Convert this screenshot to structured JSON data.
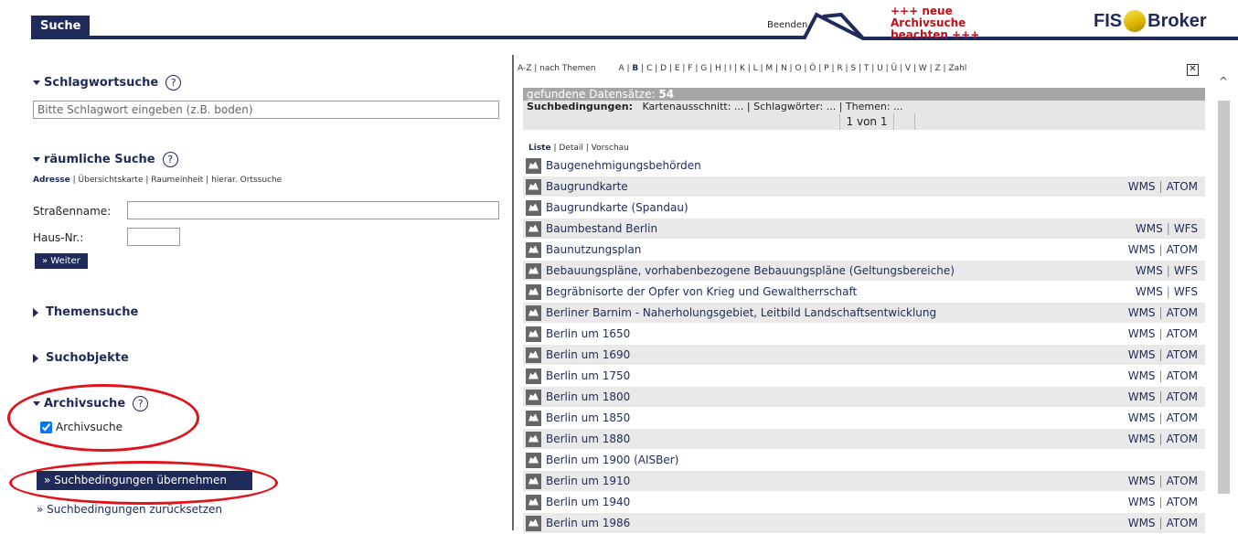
{
  "header": {
    "tab_label": "Suche",
    "beenden": "Beenden",
    "notice_line1": "+++ neue Archivsuche",
    "notice_line2": "beachten +++",
    "logo_left": "FIS",
    "logo_right": "Broker"
  },
  "left": {
    "schlagwort": {
      "title": "Schlagwortsuche",
      "placeholder": "Bitte Schlagwort eingeben (z.B. boden)"
    },
    "raeumlich": {
      "title": "räumliche Suche",
      "nav": [
        "Adresse",
        "Übersichtskarte",
        "Raumeinheit",
        "hierar. Ortssuche"
      ],
      "street_label": "Straßenname:",
      "house_label": "Haus-Nr.:",
      "weiter": "» Weiter"
    },
    "themen": "Themensuche",
    "suchobjekte": "Suchobjekte",
    "archiv": {
      "title": "Archivsuche",
      "checkbox_label": "Archivsuche",
      "checked": true
    },
    "apply_button": "» Suchbedingungen übernehmen",
    "reset_link": "» Suchbedingungen zurücksetzen"
  },
  "right": {
    "az_nav": "A-Z | nach Themen",
    "letters": [
      "A",
      "B",
      "C",
      "D",
      "E",
      "F",
      "G",
      "H",
      "I",
      "K",
      "L",
      "M",
      "N",
      "O",
      "Ö",
      "P",
      "R",
      "S",
      "T",
      "U",
      "Ü",
      "V",
      "W",
      "Z",
      "Zahl"
    ],
    "selected_letter": "B",
    "found_label": "gefundene Datensätze:",
    "found_count": "54",
    "conditions_label": "Suchbedingungen:",
    "conditions_text": "Kartenausschnitt: ... | Schlagwörter: ... | Themen: ...",
    "page": "1 von 1",
    "views": [
      "Liste",
      "Detail",
      "Vorschau"
    ],
    "results": [
      {
        "name": "Baugenehmigungsbehörden",
        "services": []
      },
      {
        "name": "Baugrundkarte",
        "services": [
          "WMS",
          "ATOM"
        ]
      },
      {
        "name": "Baugrundkarte (Spandau)",
        "services": []
      },
      {
        "name": "Baumbestand Berlin",
        "services": [
          "WMS",
          "WFS"
        ]
      },
      {
        "name": "Baunutzungsplan",
        "services": [
          "WMS",
          "ATOM"
        ]
      },
      {
        "name": "Bebauungspläne, vorhabenbezogene Bebauungspläne (Geltungsbereiche)",
        "services": [
          "WMS",
          "WFS"
        ]
      },
      {
        "name": "Begräbnisorte der Opfer von Krieg und Gewaltherrschaft",
        "services": [
          "WMS",
          "WFS"
        ]
      },
      {
        "name": "Berliner Barnim - Naherholungsgebiet, Leitbild Landschaftsentwicklung",
        "services": [
          "WMS",
          "ATOM"
        ]
      },
      {
        "name": "Berlin um 1650",
        "services": [
          "WMS",
          "ATOM"
        ]
      },
      {
        "name": "Berlin um 1690",
        "services": [
          "WMS",
          "ATOM"
        ]
      },
      {
        "name": "Berlin um 1750",
        "services": [
          "WMS",
          "ATOM"
        ]
      },
      {
        "name": "Berlin um 1800",
        "services": [
          "WMS",
          "ATOM"
        ]
      },
      {
        "name": "Berlin um 1850",
        "services": [
          "WMS",
          "ATOM"
        ]
      },
      {
        "name": "Berlin um 1880",
        "services": [
          "WMS",
          "ATOM"
        ]
      },
      {
        "name": "Berlin um 1900 (AISBer)",
        "services": []
      },
      {
        "name": "Berlin um 1910",
        "services": [
          "WMS",
          "ATOM"
        ]
      },
      {
        "name": "Berlin um 1940",
        "services": [
          "WMS",
          "ATOM"
        ]
      },
      {
        "name": "Berlin um 1986",
        "services": [
          "WMS",
          "ATOM"
        ]
      }
    ]
  },
  "colors": {
    "navy": "#1e2a5a",
    "highlight_red": "#e0121b",
    "notice_red": "#c0101a"
  }
}
